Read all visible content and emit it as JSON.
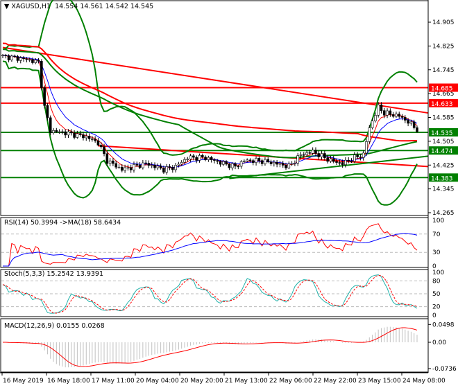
{
  "header": {
    "symbol": "XAGUSD,H1",
    "open": "14.554",
    "high": "14.561",
    "low": "14.542",
    "close": "14.545"
  },
  "price_axis": [
    "14.905",
    "14.825",
    "14.745",
    "14.665",
    "14.585",
    "14.505",
    "14.425",
    "14.345",
    "14.265"
  ],
  "levels": [
    {
      "price": 14.685,
      "label": "14.685",
      "color": "#ff0000"
    },
    {
      "price": 14.633,
      "label": "14.633",
      "color": "#ff0000"
    },
    {
      "price": 14.535,
      "label": "14.535",
      "color": "#008000"
    },
    {
      "price": 14.474,
      "label": "14.474",
      "color": "#008000"
    },
    {
      "price": 14.383,
      "label": "14.383",
      "color": "#008000"
    }
  ],
  "rsi": {
    "title": "RSI(14) 50.3994  ->MA(18) 58.6434",
    "axis": [
      "100",
      "70",
      "30",
      "0"
    ]
  },
  "stoch": {
    "title": "Stoch(5,3,3) 15.2542 13.9391",
    "axis": [
      "100",
      "80",
      "50",
      "20",
      "0"
    ]
  },
  "macd": {
    "title": "MACD(12,26,9) 0.0155 0.0268",
    "axis": [
      "0.0498",
      "0.00",
      "-0.0736"
    ]
  },
  "time_axis": [
    "16 May 2019",
    "16 May 18:00",
    "17 May 11:00",
    "20 May 04:00",
    "20 May 20:00",
    "21 May 13:00",
    "22 May 06:00",
    "22 May 22:00",
    "23 May 15:00",
    "24 May 08:00"
  ],
  "chart_data": {
    "type": "candlestick",
    "bars": 140,
    "anchors": [
      [
        0,
        14.79
      ],
      [
        8,
        14.78
      ],
      [
        12,
        14.77
      ],
      [
        14,
        14.62
      ],
      [
        16,
        14.54
      ],
      [
        20,
        14.535
      ],
      [
        28,
        14.52
      ],
      [
        32,
        14.5
      ],
      [
        35,
        14.44
      ],
      [
        40,
        14.41
      ],
      [
        48,
        14.43
      ],
      [
        54,
        14.41
      ],
      [
        58,
        14.42
      ],
      [
        62,
        14.45
      ],
      [
        68,
        14.45
      ],
      [
        74,
        14.43
      ],
      [
        78,
        14.42
      ],
      [
        81,
        14.44
      ],
      [
        86,
        14.44
      ],
      [
        92,
        14.43
      ],
      [
        96,
        14.42
      ],
      [
        100,
        14.46
      ],
      [
        104,
        14.47
      ],
      [
        110,
        14.44
      ],
      [
        114,
        14.43
      ],
      [
        118,
        14.45
      ],
      [
        121,
        14.46
      ],
      [
        123,
        14.55
      ],
      [
        126,
        14.62
      ],
      [
        128,
        14.6
      ],
      [
        133,
        14.59
      ],
      [
        136,
        14.57
      ],
      [
        139,
        14.545
      ]
    ],
    "trendlines": [
      {
        "from": [
          0,
          14.82
        ],
        "to": [
          146,
          14.6
        ],
        "color": "#ff0000"
      },
      {
        "from": [
          32,
          14.49
        ],
        "to": [
          146,
          14.42
        ],
        "color": "#ff0000"
      },
      {
        "from": [
          76,
          14.38
        ],
        "to": [
          146,
          14.455
        ],
        "color": "#008000"
      }
    ],
    "colors": {
      "bull": "#008000",
      "bear": "#008000",
      "bb": "#008000",
      "ma_long": "#ff0000",
      "ma_mid": "#008000"
    }
  }
}
